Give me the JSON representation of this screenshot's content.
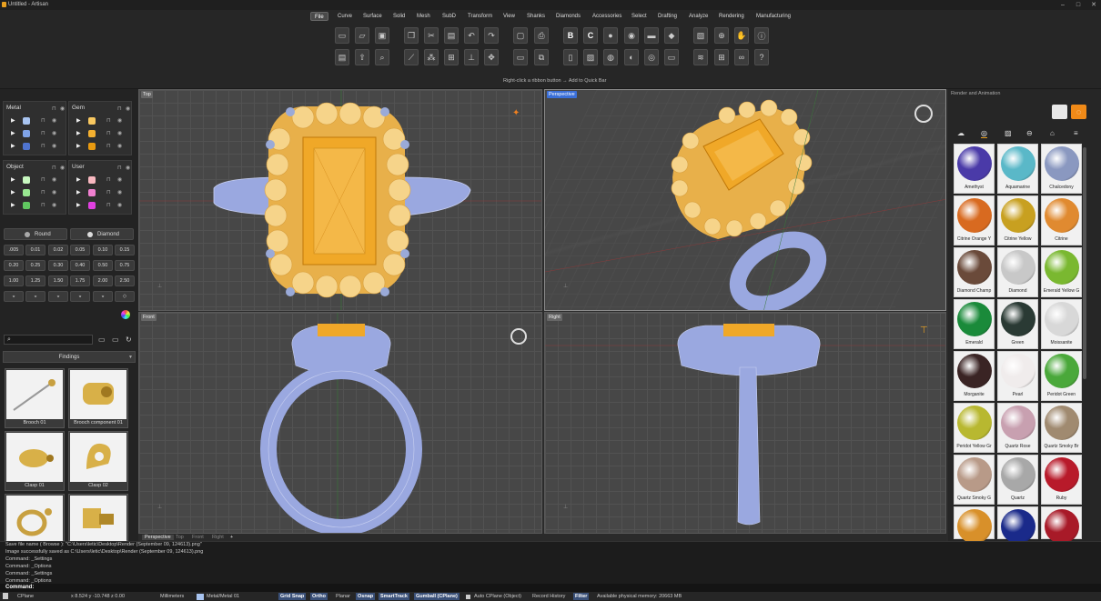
{
  "window": {
    "title": "Untitled - Artisan"
  },
  "menu": [
    "File",
    "Curve",
    "Surface",
    "Solid",
    "Mesh",
    "SubD",
    "Transform",
    "View",
    "Shanks",
    "Diamonds",
    "Accessories",
    "Select",
    "Drafting",
    "Analyze",
    "Rendering",
    "Manufacturing"
  ],
  "ribbon_hint": "Right-click a ribbon button → Add to Quick Bar",
  "layers": {
    "metal": "Metal",
    "gem": "Gem",
    "object": "Object",
    "user": "User",
    "metal_colors": [
      "#a8c4f0",
      "#7fa3e8",
      "#4f74d0"
    ],
    "gem_colors": [
      "#f8c860",
      "#f4b030",
      "#e89a10"
    ],
    "object_colors": [
      "#c8f8c0",
      "#98e890",
      "#60c860"
    ],
    "user_colors": [
      "#f8b8c0",
      "#f080d0",
      "#e040e0"
    ]
  },
  "stone": {
    "shape1": "Round",
    "shape2": "Diamond",
    "sizes": [
      ".005",
      "0.01",
      "0.02",
      "0.05",
      "0.10",
      "0.15",
      "0.20",
      "0.25",
      "0.30",
      "0.40",
      "0.50",
      "0.75",
      "1.00",
      "1.25",
      "1.50",
      "1.75",
      "2.00",
      "2.50"
    ]
  },
  "library": {
    "category": "Findings",
    "items": [
      "Brooch 01",
      "Brooch component 01",
      "Clasp 01",
      "Clasp 02",
      "",
      ""
    ]
  },
  "viewports": {
    "top": "Top",
    "perspective": "Perspective",
    "front": "Front",
    "right": "Right"
  },
  "viewport_tabs": [
    "Perspective",
    "Top",
    "Front",
    "Right",
    "+"
  ],
  "render_panel": {
    "title": "Render and Animation",
    "materials": [
      {
        "name": "Amethyst",
        "color": "#4a3aa8"
      },
      {
        "name": "Aquamarine",
        "color": "#5ab8c8"
      },
      {
        "name": "Chalcedony",
        "color": "#8a98c0"
      },
      {
        "name": "Citrine Orange Y",
        "color": "#d86a20"
      },
      {
        "name": "Citrine Yellow",
        "color": "#c8a020"
      },
      {
        "name": "Citrine",
        "color": "#e08a30"
      },
      {
        "name": "Diamond Champ",
        "color": "#6a4a3a"
      },
      {
        "name": "Diamond",
        "color": "#c8c8c8"
      },
      {
        "name": "Emerald Yellow G",
        "color": "#7ab830"
      },
      {
        "name": "Emerald",
        "color": "#1a8a3a"
      },
      {
        "name": "Green",
        "color": "#2a3a34"
      },
      {
        "name": "Moissanite",
        "color": "#d8d8d8"
      },
      {
        "name": "Morganite",
        "color": "#3a2424"
      },
      {
        "name": "Pearl",
        "color": "#f0ecec"
      },
      {
        "name": "Peridot Green",
        "color": "#4aa83a"
      },
      {
        "name": "Peridot Yellow Gr",
        "color": "#b8b830"
      },
      {
        "name": "Quartz Rose",
        "color": "#c8a0b0"
      },
      {
        "name": "Quartz Smoky Br",
        "color": "#a08a70"
      },
      {
        "name": "Quartz Smoky G",
        "color": "#b89a88"
      },
      {
        "name": "Quartz",
        "color": "#a8a8a8"
      },
      {
        "name": "Ruby",
        "color": "#b81a2a"
      },
      {
        "name": "",
        "color": "#d8902a"
      },
      {
        "name": "",
        "color": "#1a2a8a"
      },
      {
        "name": "",
        "color": "#a81a28"
      }
    ]
  },
  "command_history": [
    "Save file name ( Browse ): \"C:\\Users\\letic\\Desktop\\Render (September 09, 124613).png\"",
    "Image successfully saved as C:\\Users\\letic\\Desktop\\Render (September 09, 124613).png",
    "Command: _Settings",
    "Command: _Options",
    "Command: _Settings",
    "Command: _Options"
  ],
  "command_prompt": "Command:",
  "status": {
    "cplane": "CPlane",
    "coords": "x 8.524   y -10.748   z 0.00",
    "units": "Millimeters",
    "layer": "Metal/Metal 01",
    "grid_snap": "Grid Snap",
    "ortho": "Ortho",
    "planar": "Planar",
    "osnap": "Osnap",
    "smarttrack": "SmartTrack",
    "gumball": "Gumball (CPlane)",
    "auto_cplane": "Auto CPlane (Object)",
    "record_history": "Record History",
    "filter": "Filter",
    "memory": "Available physical memory: 20663 MB"
  }
}
